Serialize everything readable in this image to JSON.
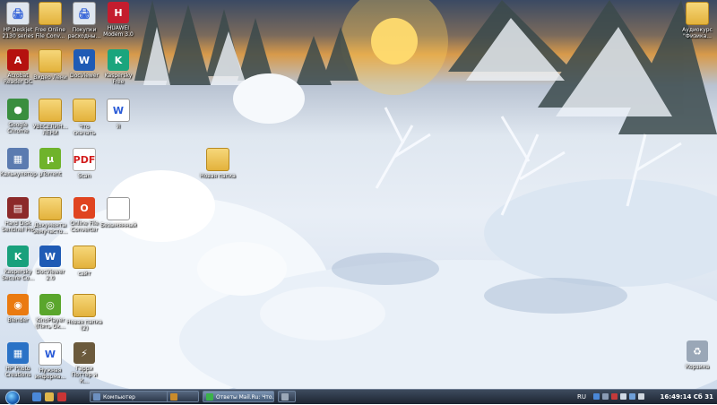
{
  "desktop": {
    "icons": [
      {
        "name": "hp-deskjet-icon",
        "label": "HP Deskjet\n2130 series",
        "glyph": "🖨",
        "cls": "doc"
      },
      {
        "name": "free-online-file-icon",
        "label": "Free Online\nFile Conv...",
        "glyph": "",
        "cls": "folder"
      },
      {
        "name": "pokupki-icon",
        "label": "Покупки\nрасходны...",
        "glyph": "🖨",
        "cls": "doc"
      },
      {
        "name": "huawei-modem-icon",
        "label": "HUAWEI\nModem 3.0",
        "glyph": "H",
        "cls": ""
      },
      {
        "name": "acrobat-reader-icon",
        "label": "Acrobat\nReader DC",
        "glyph": "A",
        "cls": ""
      },
      {
        "name": "video-folder-icon",
        "label": "Видео Лени",
        "glyph": "",
        "cls": "folder"
      },
      {
        "name": "docviewer-icon",
        "label": "DocViewer",
        "glyph": "W",
        "cls": ""
      },
      {
        "name": "kaspersky-free-icon",
        "label": "Kaspersky\nFree",
        "glyph": "K",
        "cls": ""
      },
      {
        "name": "google-chrome-icon",
        "label": "Google\nChrome",
        "glyph": "●",
        "cls": ""
      },
      {
        "name": "uvesgalie-folder-icon",
        "label": "УВЕСЕЛИН...\nЛЕНИ",
        "glyph": "",
        "cls": "folder"
      },
      {
        "name": "chto-skachat-folder-icon",
        "label": "Что\nскачать",
        "glyph": "",
        "cls": "folder"
      },
      {
        "name": "word-doc-icon",
        "label": "Я",
        "glyph": "W",
        "cls": "doc"
      },
      {
        "name": "calculator-icon",
        "label": "Калькулятор",
        "glyph": "▦",
        "cls": ""
      },
      {
        "name": "utorrent-icon",
        "label": "µTorrent",
        "glyph": "µ",
        "cls": ""
      },
      {
        "name": "scan-icon",
        "label": "Scan",
        "glyph": "PDF",
        "cls": "pdf"
      },
      {
        "name": "new-folder-icon",
        "label": "Новая папка",
        "glyph": "",
        "cls": "folder"
      },
      {
        "name": "hard-disk-sentinel-icon",
        "label": "Hard Disk\nSentinel Pro",
        "glyph": "▤",
        "cls": ""
      },
      {
        "name": "documents-folder-icon",
        "label": "Документы\nземучасто...",
        "glyph": "",
        "cls": "folder"
      },
      {
        "name": "online-file-converter-icon",
        "label": "Online File\nConverter",
        "glyph": "O",
        "cls": ""
      },
      {
        "name": "blank-icon",
        "label": "Безымянный",
        "glyph": "",
        "cls": "doc"
      },
      {
        "name": "kaspersky-secure-icon",
        "label": "Kaspersky\nSecure Co...",
        "glyph": "K",
        "cls": ""
      },
      {
        "name": "docviewer-20-icon",
        "label": "DocViewer\n2.0",
        "glyph": "W",
        "cls": ""
      },
      {
        "name": "sait-folder-icon",
        "label": "сайт",
        "glyph": "",
        "cls": "folder"
      },
      {
        "name": "blender-icon",
        "label": "Blender",
        "glyph": "◉",
        "cls": ""
      },
      {
        "name": "kinoplay-icon",
        "label": "KinoPlayer\n(Пять Ок...",
        "glyph": "◎",
        "cls": ""
      },
      {
        "name": "new-folder-2-icon",
        "label": "Новая папка\n(2)",
        "glyph": "",
        "cls": "folder"
      },
      {
        "name": "hp-photo-creations-icon",
        "label": "HP Photo\nCreations",
        "glyph": "▦",
        "cls": ""
      },
      {
        "name": "nuzhnaya-info-icon",
        "label": "Нужная\nинформа...",
        "glyph": "W",
        "cls": "doc"
      },
      {
        "name": "harry-potter-icon",
        "label": "Гарри\nПоттер и К...",
        "glyph": "⚡",
        "cls": ""
      },
      {
        "name": "audiokurs-folder-icon",
        "label": "Аудиокурс\n\"Физика...",
        "glyph": "",
        "cls": "folder"
      },
      {
        "name": "recycle-bin-icon",
        "label": "Корзина",
        "glyph": "♻",
        "cls": ""
      }
    ],
    "icon_colors": {
      "hp-deskjet-icon": "#dfe6ef",
      "huawei-modem-icon": "#c41d2e",
      "acrobat-reader-icon": "#b5120f",
      "docviewer-icon": "#1f5bb5",
      "kaspersky-free-icon": "#1aa57d",
      "google-chrome-icon": "#3a8e3f",
      "calculator-icon": "#5b7bb0",
      "utorrent-icon": "#6fb32b",
      "hard-disk-sentinel-icon": "#8c2a2a",
      "online-file-converter-icon": "#e04420",
      "kaspersky-secure-icon": "#18a07c",
      "docviewer-20-icon": "#1f5bb5",
      "blender-icon": "#ea7a10",
      "kinoplay-icon": "#5aa62c",
      "hp-photo-creations-icon": "#2a72c6",
      "harry-potter-icon": "#6b5a3c",
      "recycle-bin-icon": "#9aa7b7",
      "pokupki-icon": "#dfe6ef"
    }
  },
  "taskbar": {
    "tasks": [
      {
        "label": "Компьютер",
        "color": "#6c8fbf",
        "active": false
      },
      {
        "label": "",
        "color": "#c98b2a",
        "active": false
      },
      {
        "label": "Ответы Mail.Ru: Что...",
        "color": "#3bb24a",
        "active": true
      },
      {
        "label": "",
        "color": "#9aa7b7",
        "active": false
      }
    ],
    "quicklaunch": [
      {
        "name": "show-desktop-icon",
        "color": "#4a88d8"
      },
      {
        "name": "explorer-icon",
        "color": "#e0b74a"
      },
      {
        "name": "media-icon",
        "color": "#c93535"
      }
    ],
    "language": "RU",
    "clock": "16:49:14 Сб 31"
  }
}
